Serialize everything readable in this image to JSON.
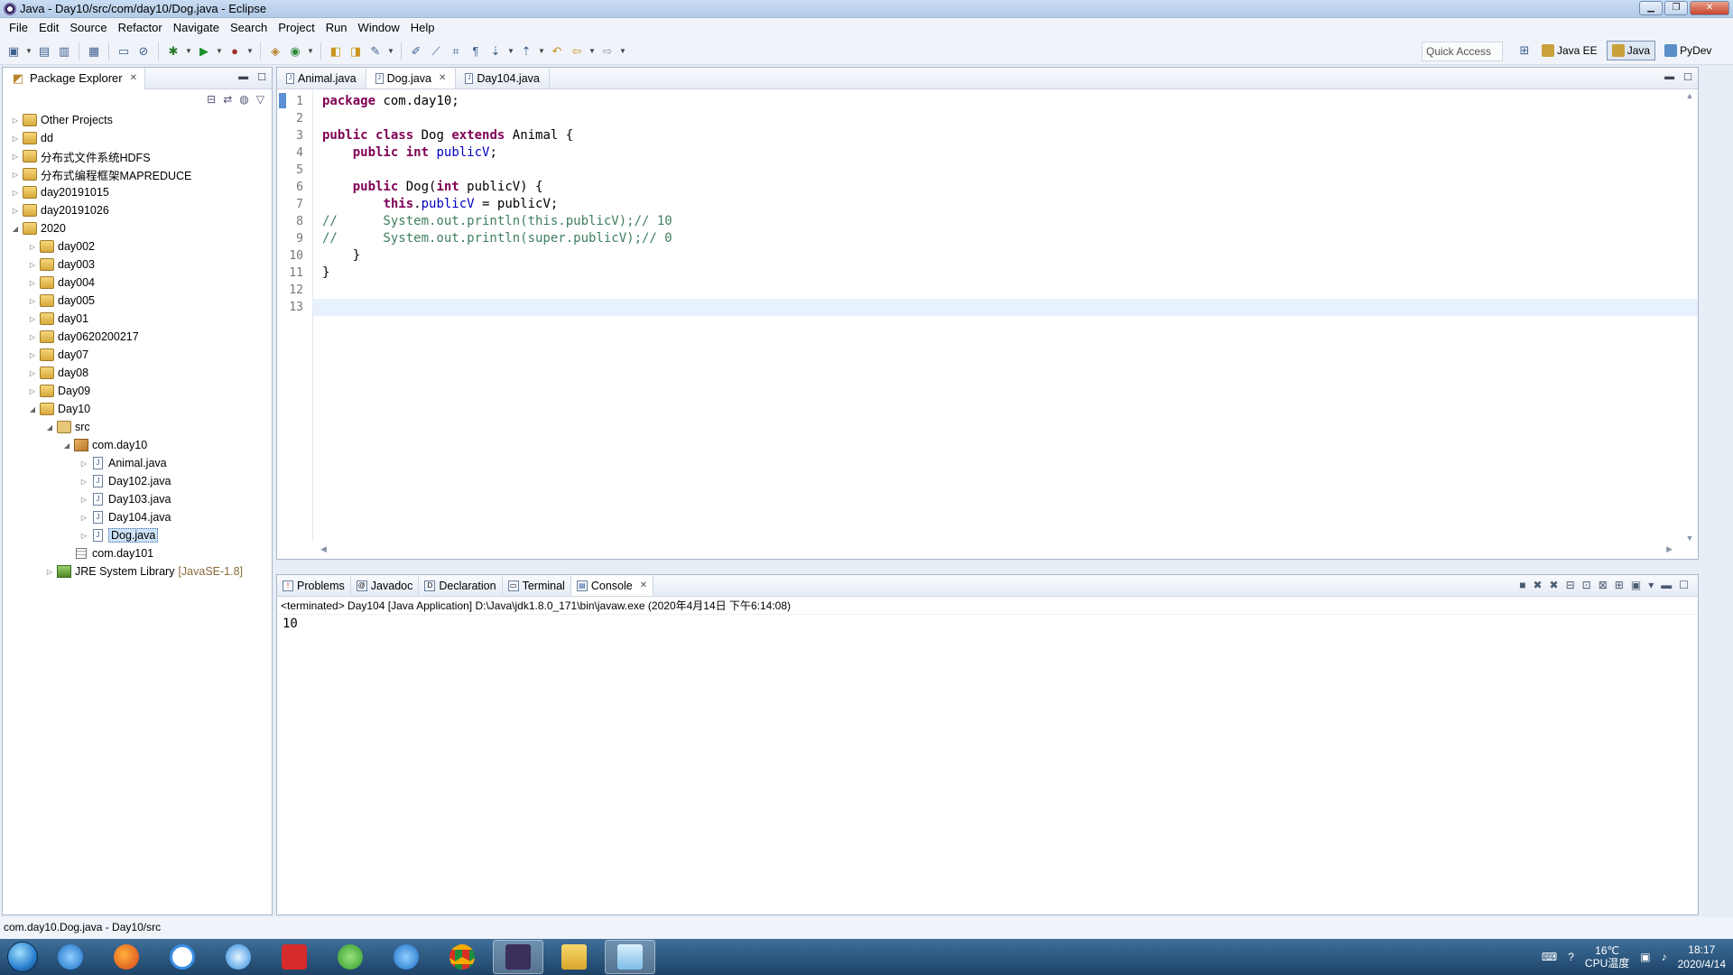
{
  "window": {
    "title": "Java - Day10/src/com/day10/Dog.java - Eclipse"
  },
  "menu": [
    "File",
    "Edit",
    "Source",
    "Refactor",
    "Navigate",
    "Search",
    "Project",
    "Run",
    "Window",
    "Help"
  ],
  "toolbar": {
    "quick_access": "Quick Access",
    "perspectives": [
      {
        "label": "Java EE",
        "active": false
      },
      {
        "label": "Java",
        "active": true
      },
      {
        "label": "PyDev",
        "active": false
      }
    ]
  },
  "package_explorer": {
    "title": "Package Explorer",
    "items": [
      {
        "label": "Other Projects",
        "level": 0,
        "expanded": false,
        "kind": "project"
      },
      {
        "label": "dd",
        "level": 0,
        "expanded": false,
        "kind": "project"
      },
      {
        "label": "分布式文件系统HDFS",
        "level": 0,
        "expanded": false,
        "kind": "project"
      },
      {
        "label": "分布式编程框架MAPREDUCE",
        "level": 0,
        "expanded": false,
        "kind": "project"
      },
      {
        "label": "day20191015",
        "level": 0,
        "expanded": false,
        "kind": "project"
      },
      {
        "label": "day20191026",
        "level": 0,
        "expanded": false,
        "kind": "project"
      },
      {
        "label": "2020",
        "level": 0,
        "expanded": true,
        "kind": "project"
      },
      {
        "label": "day002",
        "level": 1,
        "expanded": false,
        "kind": "project"
      },
      {
        "label": "day003",
        "level": 1,
        "expanded": false,
        "kind": "project"
      },
      {
        "label": "day004",
        "level": 1,
        "expanded": false,
        "kind": "project"
      },
      {
        "label": "day005",
        "level": 1,
        "expanded": false,
        "kind": "project"
      },
      {
        "label": "day01",
        "level": 1,
        "expanded": false,
        "kind": "project"
      },
      {
        "label": "day0620200217",
        "level": 1,
        "expanded": false,
        "kind": "project"
      },
      {
        "label": "day07",
        "level": 1,
        "expanded": false,
        "kind": "project"
      },
      {
        "label": "day08",
        "level": 1,
        "expanded": false,
        "kind": "project"
      },
      {
        "label": "Day09",
        "level": 1,
        "expanded": false,
        "kind": "project"
      },
      {
        "label": "Day10",
        "level": 1,
        "expanded": true,
        "kind": "project"
      },
      {
        "label": "src",
        "level": 2,
        "expanded": true,
        "kind": "src"
      },
      {
        "label": "com.day10",
        "level": 3,
        "expanded": true,
        "kind": "package"
      },
      {
        "label": "Animal.java",
        "level": 4,
        "expanded": false,
        "kind": "file"
      },
      {
        "label": "Day102.java",
        "level": 4,
        "expanded": false,
        "kind": "file"
      },
      {
        "label": "Day103.java",
        "level": 4,
        "expanded": false,
        "kind": "file"
      },
      {
        "label": "Day104.java",
        "level": 4,
        "expanded": false,
        "kind": "file"
      },
      {
        "label": "Dog.java",
        "level": 4,
        "expanded": false,
        "kind": "file",
        "selected": true
      },
      {
        "label": "com.day101",
        "level": 3,
        "expanded": null,
        "kind": "empty-package"
      },
      {
        "label": "JRE System Library",
        "level": 2,
        "expanded": false,
        "kind": "library",
        "tag": "[JavaSE-1.8]"
      }
    ]
  },
  "editor": {
    "tabs": [
      {
        "label": "Animal.java",
        "active": false
      },
      {
        "label": "Dog.java",
        "active": true
      },
      {
        "label": "Day104.java",
        "active": false
      }
    ],
    "line_numbers": [
      "1",
      "2",
      "3",
      "4",
      "5",
      "6",
      "7",
      "8",
      "9",
      "10",
      "11",
      "12",
      "13"
    ],
    "code": {
      "l1_kw": "package",
      "l1_rest": " com.day10;",
      "l3_kw1": "public",
      "l3_kw2": "class",
      "l3_name": " Dog ",
      "l3_kw3": "extends",
      "l3_rest": " Animal {",
      "l4_kw1": "public",
      "l4_kw2": "int",
      "l4_field": "publicV",
      "l4_rest": ";",
      "l6_kw1": "public",
      "l6_mid": " Dog(",
      "l6_kw2": "int",
      "l6_rest": " publicV) {",
      "l7_kw": "this",
      "l7_dot": ".",
      "l7_field": "publicV",
      "l7_rest": " = publicV;",
      "l8": "//      System.out.println(this.publicV);// 10",
      "l9": "//      System.out.println(super.publicV);// 0",
      "l10": "    }",
      "l11": "}"
    }
  },
  "console": {
    "tabs": [
      "Problems",
      "Javadoc",
      "Declaration",
      "Terminal",
      "Console"
    ],
    "active_tab": "Console",
    "status": "<terminated> Day104 [Java Application] D:\\Java\\jdk1.8.0_171\\bin\\javaw.exe (2020年4月14日 下午6:14:08)",
    "output": "10"
  },
  "statusbar": {
    "text": "com.day10.Dog.java - Day10/src"
  },
  "taskbar": {
    "temperature": "16℃",
    "temp_label": "CPU温度",
    "time": "18:17",
    "date": "2020/4/14"
  }
}
